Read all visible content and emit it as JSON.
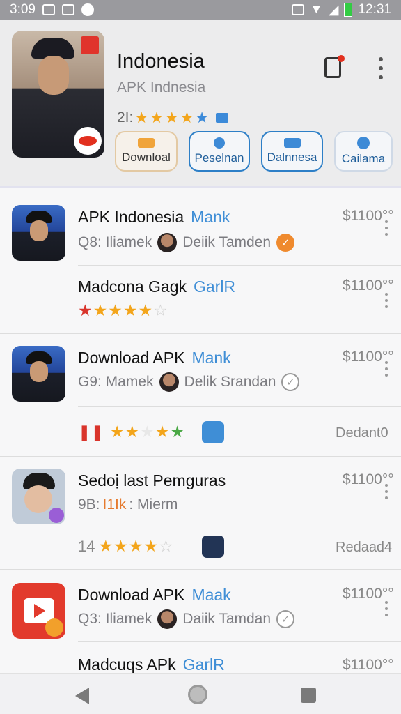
{
  "status": {
    "time": "3:09",
    "clock": "12:31"
  },
  "header": {
    "title": "Indonesia",
    "subtitle": "APK  Indnesia",
    "rating_prefix": "2I:",
    "chips": [
      {
        "label": "Downloal",
        "icon": "download-icon"
      },
      {
        "label": "Peselnan",
        "icon": "search-icon"
      },
      {
        "label": "Dalnnesa",
        "icon": "mail-icon"
      },
      {
        "label": "Cailama",
        "icon": "compass-icon"
      }
    ]
  },
  "list": [
    {
      "title": "APK Indonesia",
      "accent": "Mank",
      "sub_prefix": "Q8: Iliamek",
      "author": "Deiik Tamden",
      "price": "$1100°°",
      "verify": "orange"
    },
    {
      "title": "Madcona Gagk",
      "accent": "GarlR",
      "price": "$1100°°",
      "rating": "4.5"
    },
    {
      "title": "Download APK",
      "accent": "Mank",
      "sub_prefix": "G9: Mamek",
      "author": "Delik Srandan",
      "price": "$1100°°",
      "verify": "grey"
    },
    {
      "rating_text": "Dedant0"
    },
    {
      "title": "Sedoị last Pemguras",
      "sub_prefix": "9B:",
      "sub_highlight": "I1Ik",
      "sub_rest": ": Mierm",
      "price": "$1100°°"
    },
    {
      "rating_prefix": "14",
      "rating_text": "Redaad4"
    },
    {
      "title": "Download APK",
      "accent": "Maak",
      "sub_prefix": "Q3: Iliamek",
      "author": "Daiik Tamdan",
      "price": "$1100°°",
      "verify": "grey"
    },
    {
      "title": "Madcuqs APk",
      "accent": "GarlR",
      "price": "$1100°°"
    }
  ],
  "colors": {
    "accent": "#3f8ed6",
    "star": "#f3a51b",
    "danger": "#d9342b"
  }
}
